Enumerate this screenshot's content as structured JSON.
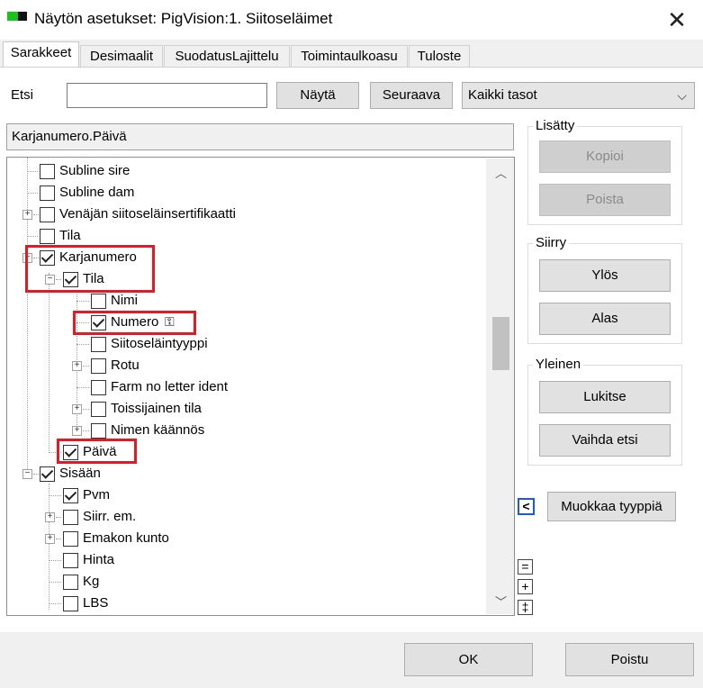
{
  "window": {
    "title": "Näytön asetukset: PigVision:1. Siitoseläimet",
    "close_glyph": "✕"
  },
  "tabs": [
    {
      "label": "Sarakkeet"
    },
    {
      "label": "Desimaalit"
    },
    {
      "label": "SuodatusLajittelu"
    },
    {
      "label": "Toimintaulkoasu"
    },
    {
      "label": "Tuloste"
    }
  ],
  "search": {
    "label": "Etsi",
    "value": "",
    "show_button": "Näytä",
    "next_button": "Seuraava",
    "level_select": "Kaikki tasot"
  },
  "path_field": "Karjanumero.Päivä",
  "tree": [
    {
      "label": "Subline sire",
      "checked": false,
      "expander": ""
    },
    {
      "label": "Subline dam",
      "checked": false,
      "expander": ""
    },
    {
      "label": "Venäjän siitoseläinsertifikaatti",
      "checked": false,
      "expander": "+"
    },
    {
      "label": "Tila",
      "checked": false,
      "expander": ""
    },
    {
      "label": "Karjanumero",
      "checked": true,
      "expander": "−"
    },
    {
      "label": "Tila",
      "checked": true,
      "expander": "−"
    },
    {
      "label": "Nimi",
      "checked": false,
      "expander": ""
    },
    {
      "label": "Numero",
      "checked": true,
      "expander": ""
    },
    {
      "label": "Siitoseläintyyppi",
      "checked": false,
      "expander": ""
    },
    {
      "label": "Rotu",
      "checked": false,
      "expander": "+"
    },
    {
      "label": "Farm no letter ident",
      "checked": false,
      "expander": ""
    },
    {
      "label": "Toissijainen tila",
      "checked": false,
      "expander": "+"
    },
    {
      "label": "Nimen käännös",
      "checked": false,
      "expander": "+"
    },
    {
      "label": "Päivä",
      "checked": true,
      "expander": ""
    },
    {
      "label": "Sisään",
      "checked": true,
      "expander": "−"
    },
    {
      "label": "Pvm",
      "checked": true,
      "expander": ""
    },
    {
      "label": "Siirr. em.",
      "checked": false,
      "expander": "+"
    },
    {
      "label": "Emakon kunto",
      "checked": false,
      "expander": "+"
    },
    {
      "label": "Hinta",
      "checked": false,
      "expander": ""
    },
    {
      "label": "Kg",
      "checked": false,
      "expander": ""
    },
    {
      "label": "LBS",
      "checked": false,
      "expander": ""
    }
  ],
  "groups": {
    "added": {
      "label": "Lisätty",
      "copy_button": "Kopioi",
      "delete_button": "Poista"
    },
    "move": {
      "label": "Siirry",
      "up_button": "Ylös",
      "down_button": "Alas"
    },
    "general": {
      "label": "Yleinen",
      "lock_button": "Lukitse",
      "switch_search_button": "Vaihda etsi"
    }
  },
  "edit_type_button": "Muokkaa tyyppiä",
  "collapse_arrow": "<",
  "size_buttons": [
    "=",
    "+",
    "‡"
  ],
  "footer": {
    "ok_button": "OK",
    "exit_button": "Poistu"
  },
  "colors": {
    "highlight": "#e01b24",
    "app_icon_green": "#18c418"
  }
}
